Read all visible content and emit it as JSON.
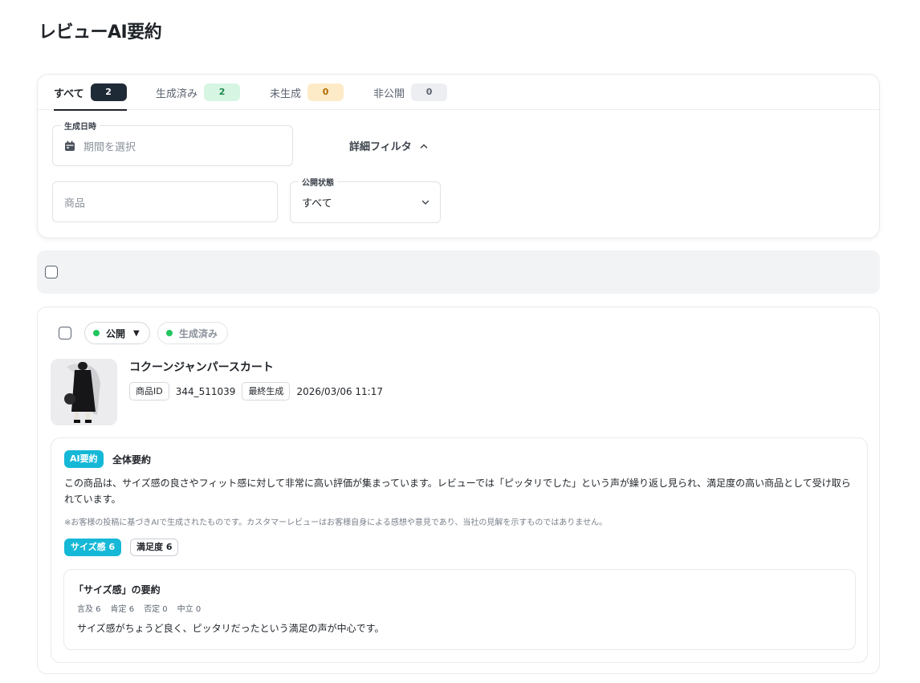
{
  "page": {
    "title": "レビューAI要約"
  },
  "tabs": [
    {
      "label": "すべて",
      "count": "2"
    },
    {
      "label": "生成済み",
      "count": "2"
    },
    {
      "label": "未生成",
      "count": "0"
    },
    {
      "label": "非公開",
      "count": "0"
    }
  ],
  "filters": {
    "date": {
      "label": "生成日時",
      "placeholder": "期間を選択"
    },
    "detail_toggle": "詳細フィルタ",
    "product": {
      "placeholder": "商品"
    },
    "visibility": {
      "label": "公開状態",
      "value": "すべて"
    }
  },
  "review": {
    "status_label": "公開",
    "generated_label": "生成済み",
    "product_name": "コクーンジャンパースカート",
    "product_id_label": "商品ID",
    "product_id": "344_511039",
    "last_generated_label": "最終生成",
    "last_generated": "2026/03/06 11:17",
    "summary": {
      "badge": "AI要約",
      "title": "全体要約",
      "text": "この商品は、サイズ感の良さやフィット感に対して非常に高い評価が集まっています。レビューでは「ピッタリでした」という声が繰り返し見られ、満足度の高い商品として受け取られています。",
      "disclaimer": "※お客様の投稿に基づきAIで生成されたものです。カスタマーレビューはお客様自身による感想や意見であり、当社の見解を示すものではありません。"
    },
    "aspects": [
      {
        "label": "サイズ感 6",
        "active": true
      },
      {
        "label": "満足度 6",
        "active": false
      }
    ],
    "aspect_detail": {
      "title": "「サイズ感」の要約",
      "stats": [
        "言及 6",
        "肯定 6",
        "否定 0",
        "中立 0"
      ],
      "text": "サイズ感がちょうど良く、ピッタリだったという満足の声が中心です。"
    }
  },
  "colors": {
    "accent": "#15b8d6",
    "status_green": "#22c55e",
    "dark": "#1f2a37"
  }
}
